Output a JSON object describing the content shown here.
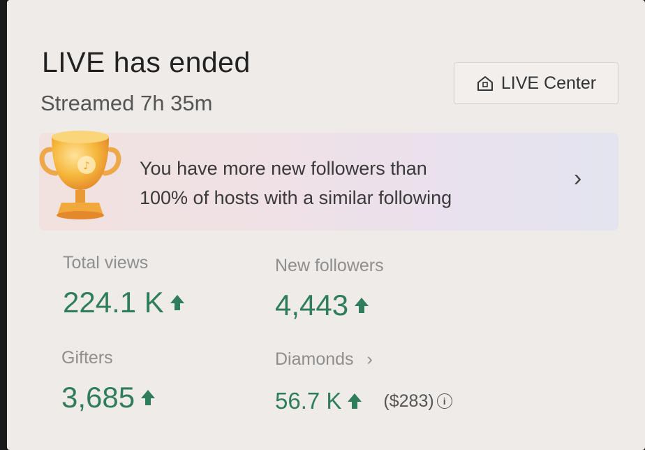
{
  "header": {
    "title": "LIVE has ended",
    "subtitle": "Streamed 7h 35m",
    "live_center_label": "LIVE Center"
  },
  "banner": {
    "line1": "You have more new followers than",
    "line2": "100% of hosts with a similar following",
    "chevron": "›"
  },
  "stats": {
    "total_views": {
      "label": "Total views",
      "value": "224.1 K"
    },
    "new_followers": {
      "label": "New followers",
      "value": "4,443"
    },
    "gifters": {
      "label": "Gifters",
      "value": "3,685"
    },
    "diamonds": {
      "label": "Diamonds",
      "chevron": "›",
      "value": "56.7 K",
      "usd": "($283)"
    }
  },
  "colors": {
    "accent_green": "#2f7d5a",
    "background": "#efebe8",
    "trophy_gold": "#f4b63a"
  },
  "icons": [
    "home-icon",
    "trophy-icon",
    "up-arrow-icon",
    "info-icon",
    "chevron-right-icon"
  ]
}
